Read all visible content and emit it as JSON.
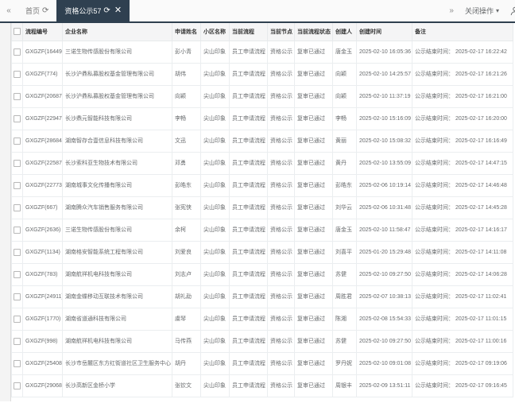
{
  "tabbar": {
    "collapse_icon": "«",
    "expand_icon": "»",
    "tabs": [
      {
        "label": "首页",
        "refresh_icon": "⟳",
        "active": false
      },
      {
        "label": "资格公示57",
        "refresh_icon": "⟳",
        "close_icon": "✕",
        "active": true
      }
    ],
    "close_ops_label": "关闭操作",
    "caret_icon": "▾",
    "accent_color": "#2f4050"
  },
  "table": {
    "columns": [
      "流程编号",
      "企业名称",
      "申请姓名",
      "小区名称",
      "当前流程",
      "当前节点",
      "当前流程状态",
      "创建人",
      "创建时间",
      "备注"
    ],
    "rows": [
      [
        "GXGZF(16449)",
        "三诺生物传感股份有限公司",
        "彭小青",
        "尖山印象",
        "员工申请流程",
        "资格公示",
        "复审已通过",
        "唐金玉",
        "2025-02-10 16:05:36",
        "公示结束时间： 2025-02-17 16:22:42"
      ],
      [
        "GXGZF(774)",
        "长沙沪鼎私募股权基金管理有限公司",
        "胡伟",
        "尖山印象",
        "员工申请流程",
        "资格公示",
        "复审已通过",
        "向颖",
        "2025-02-10 14:25:57",
        "公示结束时间： 2025-02-17 16:21:26"
      ],
      [
        "GXGZF(20687)",
        "长沙沪鼎私募股权基金管理有限公司",
        "向颖",
        "尖山印象",
        "员工申请流程",
        "资格公示",
        "复审已通过",
        "向颖",
        "2025-02-10 11:37:19",
        "公示结束时间： 2025-02-17 16:21:00"
      ],
      [
        "GXGZF(22947)",
        "长沙鼎元智能科技有限公司",
        "李畅",
        "尖山印象",
        "员工申请流程",
        "资格公示",
        "复审已通过",
        "李畅",
        "2025-02-10 15:16:09",
        "公示结束时间： 2025-02-17 16:20:00"
      ],
      [
        "GXGZF(28684)",
        "湖南智存合壹信息科技有限公司",
        "文迅",
        "尖山印象",
        "员工申请流程",
        "资格公示",
        "复审已通过",
        "黄丽",
        "2025-02-10 15:08:32",
        "公示结束时间： 2025-02-17 16:16:49"
      ],
      [
        "GXGZF(22587)",
        "长沙索科亚生物技术有限公司",
        "邓勇",
        "尖山印象",
        "员工申请流程",
        "资格公示",
        "复审已通过",
        "黄丹",
        "2025-02-10 13:55:09",
        "公示结束时间： 2025-02-17 14:47:15"
      ],
      [
        "GXGZF(22773)",
        "湖南城事文化传播有限公司",
        "彭皓东",
        "尖山印象",
        "员工申请流程",
        "资格公示",
        "复审已通过",
        "彭皓东",
        "2025-02-06 10:19:14",
        "公示结束时间： 2025-02-17 14:46:48"
      ],
      [
        "GXGZF(667)",
        "湖南腾众汽车销售服务有限公司",
        "张宪侠",
        "尖山印象",
        "员工申请流程",
        "资格公示",
        "复审已通过",
        "刘华云",
        "2025-02-06 10:31:48",
        "公示结束时间： 2025-02-17 14:45:28"
      ],
      [
        "GXGZF(2636)",
        "三诺生物传感股份有限公司",
        "余柯",
        "尖山印象",
        "员工申请流程",
        "资格公示",
        "复审已通过",
        "唐金玉",
        "2025-02-10 11:58:47",
        "公示结束时间： 2025-02-17 14:16:17"
      ],
      [
        "GXGZF(1134)",
        "湖南格安智能系统工程有限公司",
        "刘爱良",
        "尖山印象",
        "员工申请流程",
        "资格公示",
        "复审已通过",
        "刘喜平",
        "2025-01-20 15:29:48",
        "公示结束时间： 2025-02-17 14:11:08"
      ],
      [
        "GXGZF(783)",
        "湖南航祥机电科技有限公司",
        "刘志卢",
        "尖山印象",
        "员工申请流程",
        "资格公示",
        "复审已通过",
        "苏健",
        "2025-02-10 09:27:50",
        "公示结束时间： 2025-02-17 14:06:28"
      ],
      [
        "GXGZF(24911)",
        "湖南金蝶移动互联技术有限公司",
        "胡礼勐",
        "尖山印象",
        "员工申请流程",
        "资格公示",
        "复审已通过",
        "周胜君",
        "2025-02-07 10:38:13",
        "公示结束时间： 2025-02-17 11:02:41"
      ],
      [
        "GXGZF(1770)",
        "湖南省道通科技有限公司",
        "虞琴",
        "尖山印象",
        "员工申请流程",
        "资格公示",
        "复审已通过",
        "陈湘",
        "2025-02-08 15:54:33",
        "公示结束时间： 2025-02-17 11:01:15"
      ],
      [
        "GXGZF(998)",
        "湖南航祥机电科技有限公司",
        "马传燕",
        "尖山印象",
        "员工申请流程",
        "资格公示",
        "复审已通过",
        "苏健",
        "2025-02-10 09:27:50",
        "公示结束时间： 2025-02-17 11:00:16"
      ],
      [
        "GXGZF(25408)",
        "长沙市岳麓区东方红街道社区卫生服务中心",
        "胡丹",
        "尖山印象",
        "员工申请流程",
        "资格公示",
        "复审已通过",
        "罗丹妮",
        "2025-02-10 09:01:08",
        "公示结束时间： 2025-02-17 09:19:06"
      ],
      [
        "GXGZF(29068)",
        "长沙高新区金桥小学",
        "张钦文",
        "尖山印象",
        "员工申请流程",
        "资格公示",
        "复审已通过",
        "周银丰",
        "2025-02-09 13:51:11",
        "公示结束时间： 2025-02-17 09:16:45"
      ]
    ]
  }
}
